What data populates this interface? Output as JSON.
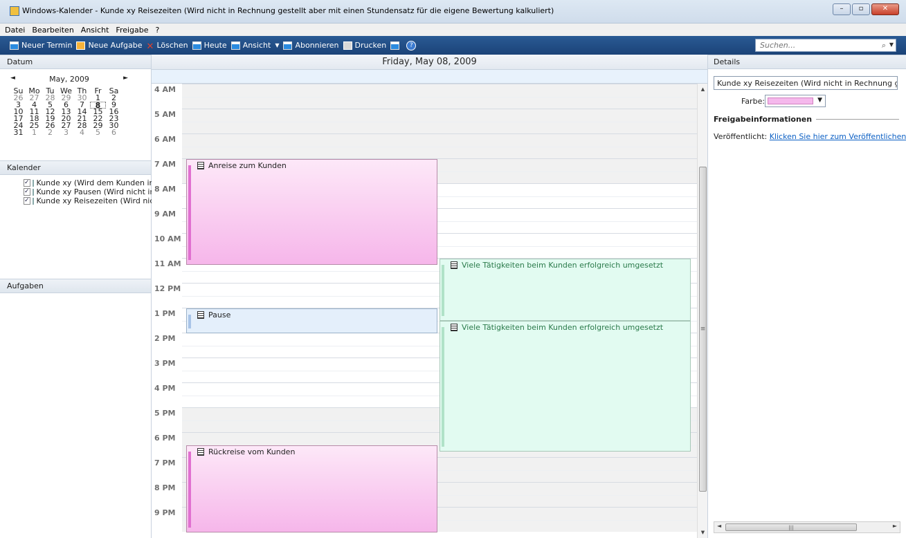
{
  "window": {
    "title": "Windows-Kalender - Kunde xy Reisezeiten (Wird nicht in Rechnung gestellt aber mit einen Stundensatz für die eigene Bewertung kalkuliert)",
    "minimize": "–",
    "maximize": "▫",
    "close": "✕"
  },
  "menu": [
    "Datei",
    "Bearbeiten",
    "Ansicht",
    "Freigabe",
    "?"
  ],
  "toolbar": {
    "new_appointment": "Neuer Termin",
    "new_task": "Neue Aufgabe",
    "delete": "Löschen",
    "today": "Heute",
    "view": "Ansicht",
    "subscribe": "Abonnieren",
    "print": "Drucken",
    "help": "?",
    "search_placeholder": "Suchen..."
  },
  "left": {
    "date_header": "Datum",
    "month_label": "May, 2009",
    "weekdays": [
      "Su",
      "Mo",
      "Tu",
      "We",
      "Th",
      "Fr",
      "Sa"
    ],
    "weeks": [
      [
        "26",
        "27",
        "28",
        "29",
        "30",
        "1",
        "2"
      ],
      [
        "3",
        "4",
        "5",
        "6",
        "7",
        "8",
        "9"
      ],
      [
        "10",
        "11",
        "12",
        "13",
        "14",
        "15",
        "16"
      ],
      [
        "17",
        "18",
        "19",
        "20",
        "21",
        "22",
        "23"
      ],
      [
        "24",
        "25",
        "26",
        "27",
        "28",
        "29",
        "30"
      ],
      [
        "31",
        "1",
        "2",
        "3",
        "4",
        "5",
        "6"
      ]
    ],
    "selected_day": "8",
    "calendars_header": "Kalender",
    "calendars": [
      "Kunde xy (Wird dem Kunden in",
      "Kunde xy Pausen (Wird nicht in",
      "Kunde xy Reisezeiten (Wird nich"
    ],
    "tasks_header": "Aufgaben"
  },
  "center": {
    "date_title": "Friday, May 08, 2009",
    "hours": [
      "4 AM",
      "5 AM",
      "6 AM",
      "7 AM",
      "8 AM",
      "9 AM",
      "10 AM",
      "11 AM",
      "12 PM",
      "1 PM",
      "2 PM",
      "3 PM",
      "4 PM",
      "5 PM",
      "6 PM",
      "7 PM",
      "8 PM",
      "9 PM"
    ],
    "events": [
      {
        "title": "Anreise zum Kunden",
        "start": "7 AM",
        "end": "11:15 AM",
        "color": "#f6b6ea"
      },
      {
        "title": "Viele Tätigkeiten beim Kunden erfolgreich umgesetzt",
        "start": "11 AM",
        "end": "1:30 PM",
        "color": "#e2fbf1"
      },
      {
        "title": "Pause",
        "start": "1 PM",
        "end": "2 PM",
        "color": "#e4effb"
      },
      {
        "title": "Viele Tätigkeiten beim Kunden erfolgreich umgesetzt",
        "start": "1:30 PM",
        "end": "6:45 PM",
        "color": "#e2fbf1"
      },
      {
        "title": "Rückreise vom Kunden",
        "start": "6:30 PM",
        "end": "10 PM",
        "color": "#f6b6ea"
      }
    ]
  },
  "right": {
    "details_header": "Details",
    "calendar_name": "Kunde xy Reisezeiten (Wird nicht in Rechnung gestellt",
    "color_label": "Farbe:",
    "color_value": "#f5b8ec",
    "sharing_header": "Freigabeinformationen",
    "published_label": "Veröffentlicht:",
    "published_link": "Klicken Sie hier zum Veröffentlichen"
  }
}
